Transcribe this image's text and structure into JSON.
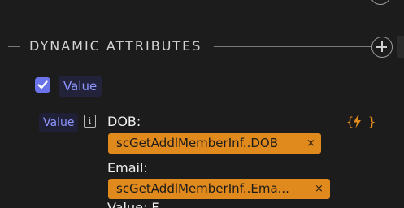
{
  "section": {
    "title": "DYNAMIC ATTRIBUTES"
  },
  "attribute": {
    "checked": true,
    "name": "Value"
  },
  "row": {
    "label": "Value",
    "info_glyph": "i",
    "bind_icon": "lightning-bolt-braces-icon"
  },
  "fields": [
    {
      "label": "DOB:",
      "token": "scGetAddlMemberInf..DOB",
      "remove": "×"
    },
    {
      "label": "Email:",
      "token": "scGetAddlMemberInf..Ema...",
      "remove": "×"
    }
  ],
  "clipped_next_label": "Value: F",
  "colors": {
    "background": "#1c1c1c",
    "accent": "#6b73ea",
    "chip_text": "#8e97ff",
    "token": "#e0891c"
  }
}
